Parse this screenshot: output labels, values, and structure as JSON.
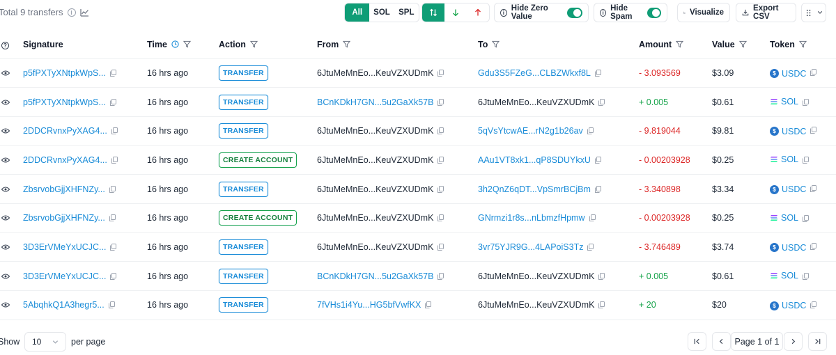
{
  "header": {
    "total_text": "Total 9 transfers",
    "type_filter": [
      "All",
      "SOL",
      "SPL"
    ],
    "hide_zero_label": "Hide Zero Value",
    "hide_spam_label": "Hide Spam",
    "visualize_label": "Visualize",
    "export_label": "Export CSV"
  },
  "columns": {
    "signature": "Signature",
    "time": "Time",
    "action": "Action",
    "from": "From",
    "to": "To",
    "amount": "Amount",
    "value": "Value",
    "token": "Token"
  },
  "rows": [
    {
      "signature": "p5fPXTyXNtpkWpS...",
      "time": "16 hrs ago",
      "action": "TRANSFER",
      "from": "6JtuMeMnEo...KeuVZXUDmK",
      "from_link": false,
      "to": "Gdu3S5FZeG...CLBZWkxf8L",
      "to_link": true,
      "amount": "- 3.093569",
      "sign": "neg",
      "value": "$3.09",
      "token": "USDC"
    },
    {
      "signature": "p5fPXTyXNtpkWpS...",
      "time": "16 hrs ago",
      "action": "TRANSFER",
      "from": "BCnKDkH7GN...5u2GaXk57B",
      "from_link": true,
      "to": "6JtuMeMnEo...KeuVZXUDmK",
      "to_link": false,
      "amount": "+ 0.005",
      "sign": "pos",
      "value": "$0.61",
      "token": "SOL"
    },
    {
      "signature": "2DDCRvnxPyXAG4...",
      "time": "16 hrs ago",
      "action": "TRANSFER",
      "from": "6JtuMeMnEo...KeuVZXUDmK",
      "from_link": false,
      "to": "5qVsYtcwAE...rN2g1b26av",
      "to_link": true,
      "amount": "- 9.819044",
      "sign": "neg",
      "value": "$9.81",
      "token": "USDC"
    },
    {
      "signature": "2DDCRvnxPyXAG4...",
      "time": "16 hrs ago",
      "action": "CREATE ACCOUNT",
      "from": "6JtuMeMnEo...KeuVZXUDmK",
      "from_link": false,
      "to": "AAu1VT8xk1...qP8SDUYkxU",
      "to_link": true,
      "amount": "- 0.00203928",
      "sign": "neg",
      "value": "$0.25",
      "token": "SOL"
    },
    {
      "signature": "ZbsrvobGjjXHFNZy...",
      "time": "16 hrs ago",
      "action": "TRANSFER",
      "from": "6JtuMeMnEo...KeuVZXUDmK",
      "from_link": false,
      "to": "3h2QnZ6qDT...VpSmrBCjBm",
      "to_link": true,
      "amount": "- 3.340898",
      "sign": "neg",
      "value": "$3.34",
      "token": "USDC"
    },
    {
      "signature": "ZbsrvobGjjXHFNZy...",
      "time": "16 hrs ago",
      "action": "CREATE ACCOUNT",
      "from": "6JtuMeMnEo...KeuVZXUDmK",
      "from_link": false,
      "to": "GNrmzi1r8s...nLbmzfHpmw",
      "to_link": true,
      "amount": "- 0.00203928",
      "sign": "neg",
      "value": "$0.25",
      "token": "SOL"
    },
    {
      "signature": "3D3ErVMeYxUCJC...",
      "time": "16 hrs ago",
      "action": "TRANSFER",
      "from": "6JtuMeMnEo...KeuVZXUDmK",
      "from_link": false,
      "to": "3vr75YJR9G...4LAPoiS3Tz",
      "to_link": true,
      "amount": "- 3.746489",
      "sign": "neg",
      "value": "$3.74",
      "token": "USDC"
    },
    {
      "signature": "3D3ErVMeYxUCJC...",
      "time": "16 hrs ago",
      "action": "TRANSFER",
      "from": "BCnKDkH7GN...5u2GaXk57B",
      "from_link": true,
      "to": "6JtuMeMnEo...KeuVZXUDmK",
      "to_link": false,
      "amount": "+ 0.005",
      "sign": "pos",
      "value": "$0.61",
      "token": "SOL"
    },
    {
      "signature": "5AbqhkQ1A3hegr5...",
      "time": "16 hrs ago",
      "action": "TRANSFER",
      "from": "7fVHs1i4Yu...HG5bfVwfKX",
      "from_link": true,
      "to": "6JtuMeMnEo...KeuVZXUDmK",
      "to_link": false,
      "amount": "+ 20",
      "sign": "pos",
      "value": "$20",
      "token": "USDC"
    }
  ],
  "footer": {
    "show_label": "Show",
    "page_size": "10",
    "per_page_label": "per page",
    "page_label": "Page 1 of 1"
  }
}
